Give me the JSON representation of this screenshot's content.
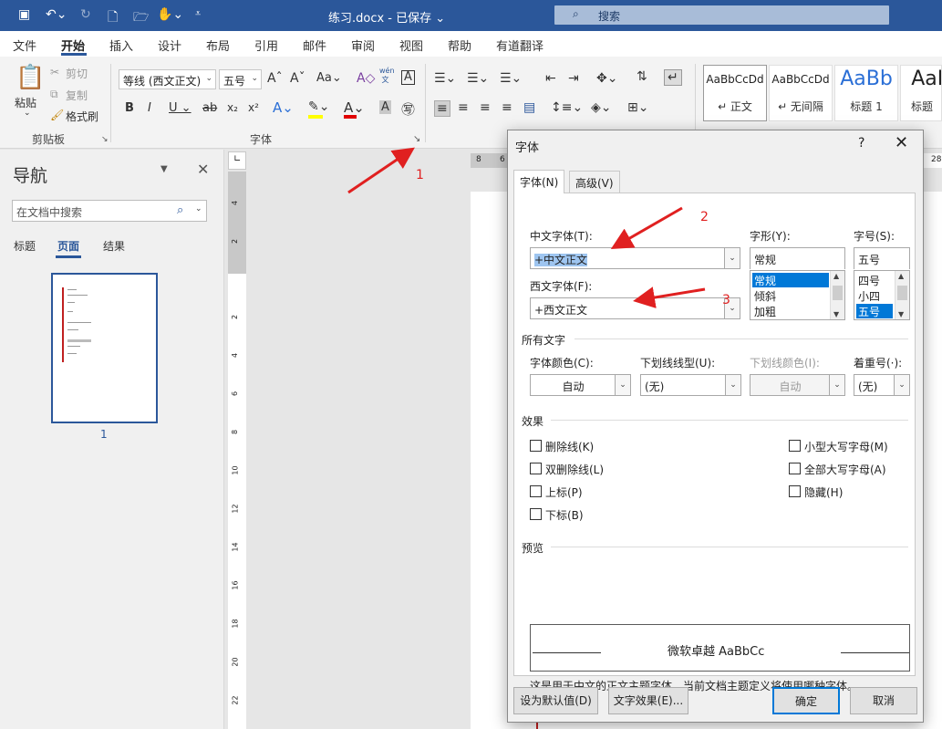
{
  "titlebar": {
    "doc_title": "练习.docx - 已保存 ⌄",
    "search_placeholder": "搜索"
  },
  "menu": {
    "items": [
      "文件",
      "开始",
      "插入",
      "设计",
      "布局",
      "引用",
      "邮件",
      "审阅",
      "视图",
      "帮助",
      "有道翻译"
    ],
    "active": "开始"
  },
  "ribbon": {
    "clipboard": {
      "paste": "粘贴",
      "cut": "剪切",
      "copy": "复制",
      "format_painter": "格式刷",
      "group_label": "剪贴板"
    },
    "font": {
      "font_name": "等线 (西文正文)",
      "font_size": "五号",
      "group_label": "字体",
      "grow": "A^",
      "shrink": "Aˇ",
      "case": "Aa",
      "phonetic": "wén 文"
    },
    "styles": [
      {
        "preview": "AaBbCcDd",
        "name": "↵ 正文"
      },
      {
        "preview": "AaBbCcDd",
        "name": "↵ 无间隔"
      },
      {
        "preview": "AaBb",
        "name": "标题 1"
      },
      {
        "preview": "AaBb",
        "name": "标题"
      }
    ]
  },
  "nav": {
    "title": "导航",
    "search_placeholder": "在文档中搜索",
    "tabs": [
      "标题",
      "页面",
      "结果"
    ],
    "active_tab": "页面",
    "page_number": "1"
  },
  "ruler": {
    "h_ticks": [
      "8",
      "6",
      "28"
    ],
    "v_ticks": [
      "4",
      "2",
      "2",
      "4",
      "6",
      "8",
      "10",
      "12",
      "14",
      "16",
      "18",
      "20",
      "22"
    ]
  },
  "dialog": {
    "title": "字体",
    "help": "?",
    "tabs": [
      "字体(N)",
      "高级(V)"
    ],
    "labels": {
      "cn_font": "中文字体(T):",
      "style": "字形(Y):",
      "size": "字号(S):",
      "west_font": "西文字体(F):",
      "all_text": "所有文字",
      "font_color": "字体颜色(C):",
      "underline_type": "下划线线型(U):",
      "underline_color": "下划线颜色(I):",
      "emphasis": "着重号(·):",
      "effects": "效果",
      "preview": "预览"
    },
    "cn_font_value": "+中文正文",
    "west_font_value": "+西文正文",
    "style_value": "常规",
    "style_list": [
      "常规",
      "倾斜",
      "加粗"
    ],
    "size_value": "五号",
    "size_list": [
      "四号",
      "小四",
      "五号"
    ],
    "font_color_value": "自动",
    "underline_type_value": "(无)",
    "underline_color_value": "自动",
    "emphasis_value": "(无)",
    "effects_left": [
      "删除线(K)",
      "双删除线(L)",
      "上标(P)",
      "下标(B)"
    ],
    "effects_right": [
      "小型大写字母(M)",
      "全部大写字母(A)",
      "隐藏(H)"
    ],
    "preview_text": "微软卓越  AaBbCc",
    "preview_desc": "这是用于中文的正文主题字体。当前文档主题定义将使用哪种字体。",
    "buttons": {
      "default": "设为默认值(D)",
      "text_effects": "文字效果(E)...",
      "ok": "确定",
      "cancel": "取消"
    }
  },
  "annotations": [
    "1",
    "2",
    "3"
  ],
  "colors": {
    "accent": "#2b579a",
    "annotation": "#e02020",
    "selection": "#0078d7"
  }
}
